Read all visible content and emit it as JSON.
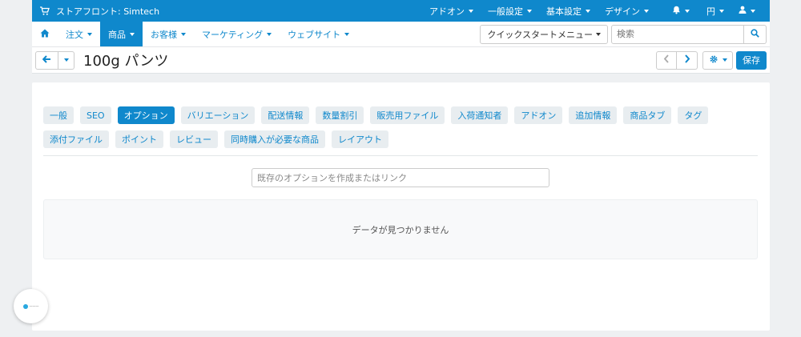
{
  "topbar": {
    "store_label": "ストアフロント: Simtech",
    "menus": [
      {
        "label": "アドオン"
      },
      {
        "label": "一般設定"
      },
      {
        "label": "基本設定"
      },
      {
        "label": "デザイン"
      }
    ],
    "currency": "円",
    "icons": [
      "cart-icon",
      "bell-icon",
      "user-icon"
    ]
  },
  "nav": {
    "items": [
      {
        "label": "注文",
        "active": false
      },
      {
        "label": "商品",
        "active": true
      },
      {
        "label": "お客様",
        "active": false
      },
      {
        "label": "マーケティング",
        "active": false
      },
      {
        "label": "ウェブサイト",
        "active": false
      }
    ],
    "quickstart_label": "クイックスタートメニュー",
    "search_placeholder": "検索"
  },
  "titlebar": {
    "title": "100g パンツ",
    "save_label": "保存"
  },
  "tabs": [
    {
      "label": "一般",
      "active": false
    },
    {
      "label": "SEO",
      "active": false
    },
    {
      "label": "オプション",
      "active": true
    },
    {
      "label": "バリエーション",
      "active": false
    },
    {
      "label": "配送情報",
      "active": false
    },
    {
      "label": "数量割引",
      "active": false
    },
    {
      "label": "販売用ファイル",
      "active": false
    },
    {
      "label": "入荷通知者",
      "active": false
    },
    {
      "label": "アドオン",
      "active": false
    },
    {
      "label": "追加情報",
      "active": false
    },
    {
      "label": "商品タブ",
      "active": false
    },
    {
      "label": "タグ",
      "active": false
    },
    {
      "label": "添付ファイル",
      "active": false
    },
    {
      "label": "ポイント",
      "active": false
    },
    {
      "label": "レビュー",
      "active": false
    },
    {
      "label": "同時購入が必要な商品",
      "active": false
    },
    {
      "label": "レイアウト",
      "active": false
    }
  ],
  "options": {
    "input_placeholder": "既存のオプションを作成またはリンク",
    "empty_message": "データが見つかりません"
  },
  "colors": {
    "brand": "#0f88cc",
    "tab_bg": "#e8edf0",
    "page_bg": "#eef0f2"
  }
}
